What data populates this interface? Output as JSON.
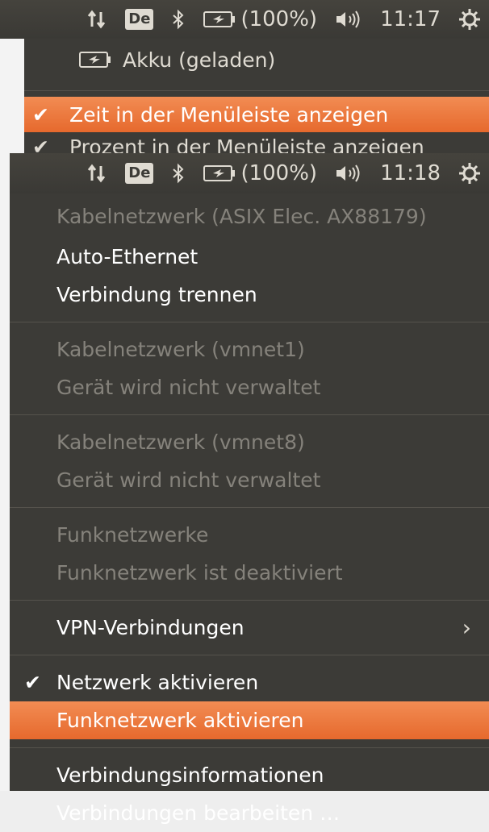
{
  "panel1": {
    "keyboard_layout": "De",
    "battery_percent": "(100%)",
    "clock": "11:17",
    "icons": [
      "network-updown-icon",
      "bluetooth-icon",
      "battery-icon",
      "volume-icon",
      "session-gear-icon"
    ]
  },
  "menu1": {
    "battery_item": "Akku (geladen)",
    "show_time": "Zeit in der Menüleiste anzeigen",
    "show_percent": "Prozent in der Menüleiste anzeigen"
  },
  "panel2": {
    "keyboard_layout": "De",
    "battery_percent": "(100%)",
    "clock": "11:18"
  },
  "menu2": {
    "wired_asix_header": "Kabelnetzwerk (ASIX Elec. AX88179)",
    "auto_ethernet": "Auto-Ethernet",
    "disconnect": "Verbindung trennen",
    "wired_vmnet1_header": "Kabelnetzwerk (vmnet1)",
    "vmnet1_status": "Gerät wird nicht verwaltet",
    "wired_vmnet8_header": "Kabelnetzwerk (vmnet8)",
    "vmnet8_status": "Gerät wird nicht verwaltet",
    "wireless_header": "Funknetzwerke",
    "wireless_status": "Funknetzwerk ist deaktiviert",
    "vpn": "VPN-Verbindungen",
    "enable_network": "Netzwerk aktivieren",
    "enable_wireless": "Funknetzwerk aktivieren",
    "connection_info": "Verbindungsinformationen",
    "edit_connections": "Verbindungen bearbeiten …"
  },
  "colors": {
    "panel": "#3c3b37",
    "highlight": "#e9703a",
    "text": "#dfdbd2",
    "disabled_text": "#85827b"
  }
}
